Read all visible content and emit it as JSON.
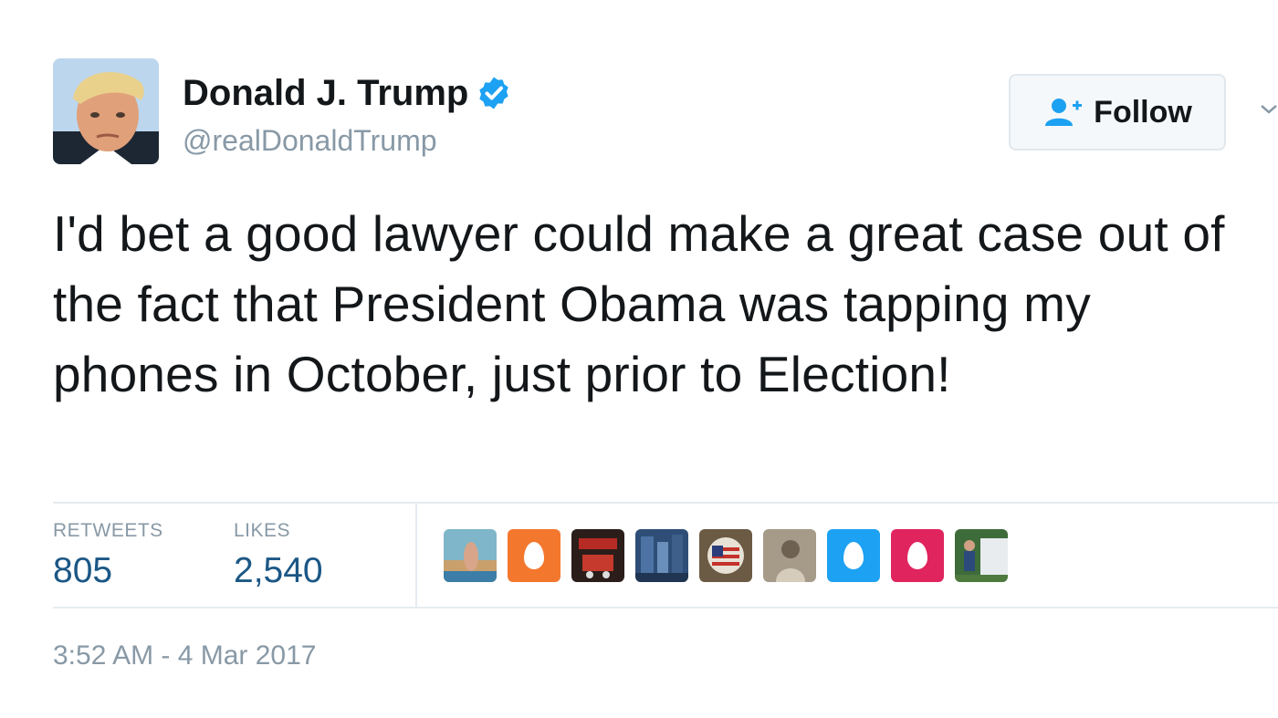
{
  "user": {
    "display_name": "Donald J. Trump",
    "handle": "@realDonaldTrump",
    "verified_icon": "verified-badge-icon",
    "avatar_icon": "profile-avatar"
  },
  "follow_button": {
    "label": "Follow",
    "icon": "add-user-icon"
  },
  "tweet": {
    "text": "I'd bet a good lawyer could make a great case out of the fact that President Obama was tapping my phones in October, just prior to Election!"
  },
  "stats": {
    "retweets_label": "RETWEETS",
    "retweets_value": "805",
    "likes_label": "LIKES",
    "likes_value": "2,540"
  },
  "likers": [
    {
      "icon": "liker-avatar-photo"
    },
    {
      "icon": "default-egg-avatar",
      "color": "#f4772e"
    },
    {
      "icon": "liker-avatar-photo"
    },
    {
      "icon": "liker-avatar-photo"
    },
    {
      "icon": "liker-avatar-flag-photo"
    },
    {
      "icon": "liker-avatar-photo"
    },
    {
      "icon": "default-egg-avatar",
      "color": "#1da1f2"
    },
    {
      "icon": "default-egg-avatar",
      "color": "#e0245e"
    },
    {
      "icon": "liker-avatar-photo"
    }
  ],
  "timestamp": "3:52 AM - 4 Mar 2017",
  "colors": {
    "text": "#14171a",
    "muted": "#8899a6",
    "stat_value": "#1b5785",
    "verified": "#1da1f2",
    "divider": "#e6ecf0"
  }
}
